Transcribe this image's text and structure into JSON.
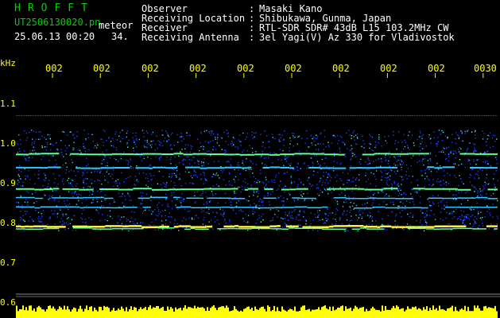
{
  "header": {
    "brand": "HROFFT",
    "filename": "UT2506130020.pn",
    "mode_label": "meteor",
    "datetime": "25.06.13 00:20",
    "count": "34."
  },
  "info": [
    {
      "label": "Observer",
      "value": "Masaki Kano"
    },
    {
      "label": "Receiving Location",
      "value": "Shibukawa, Gunma, Japan"
    },
    {
      "label": "Receiver",
      "value": "RTL-SDR SDR# 43dB L15 103.2MHz CW"
    },
    {
      "label": "Receiving Antenna",
      "value": "3el Yagi(V) Az 330 for Vladivostok"
    }
  ],
  "spectrogram": {
    "freq_unit": "kHz",
    "time_ticks": [
      "002",
      "002",
      "002",
      "002",
      "002",
      "002",
      "002",
      "002",
      "002",
      "0030"
    ],
    "freq_ticks": [
      "1.1",
      "1.0",
      "0.9",
      "0.8",
      "0.7",
      "0.6"
    ],
    "freq_range_khz": [
      0.6,
      1.1
    ],
    "signal_band_khz": [
      0.78,
      1.07
    ],
    "colors": {
      "background": "#000000",
      "noise_blue": "#1a3cff",
      "noise_cyan": "#30c8ff",
      "line_green": "#60ff90",
      "line_yellow": "#ffee40",
      "power_bar": "#ffff00",
      "label_yellow": "#ffff00",
      "label_green": "#00d000"
    }
  }
}
